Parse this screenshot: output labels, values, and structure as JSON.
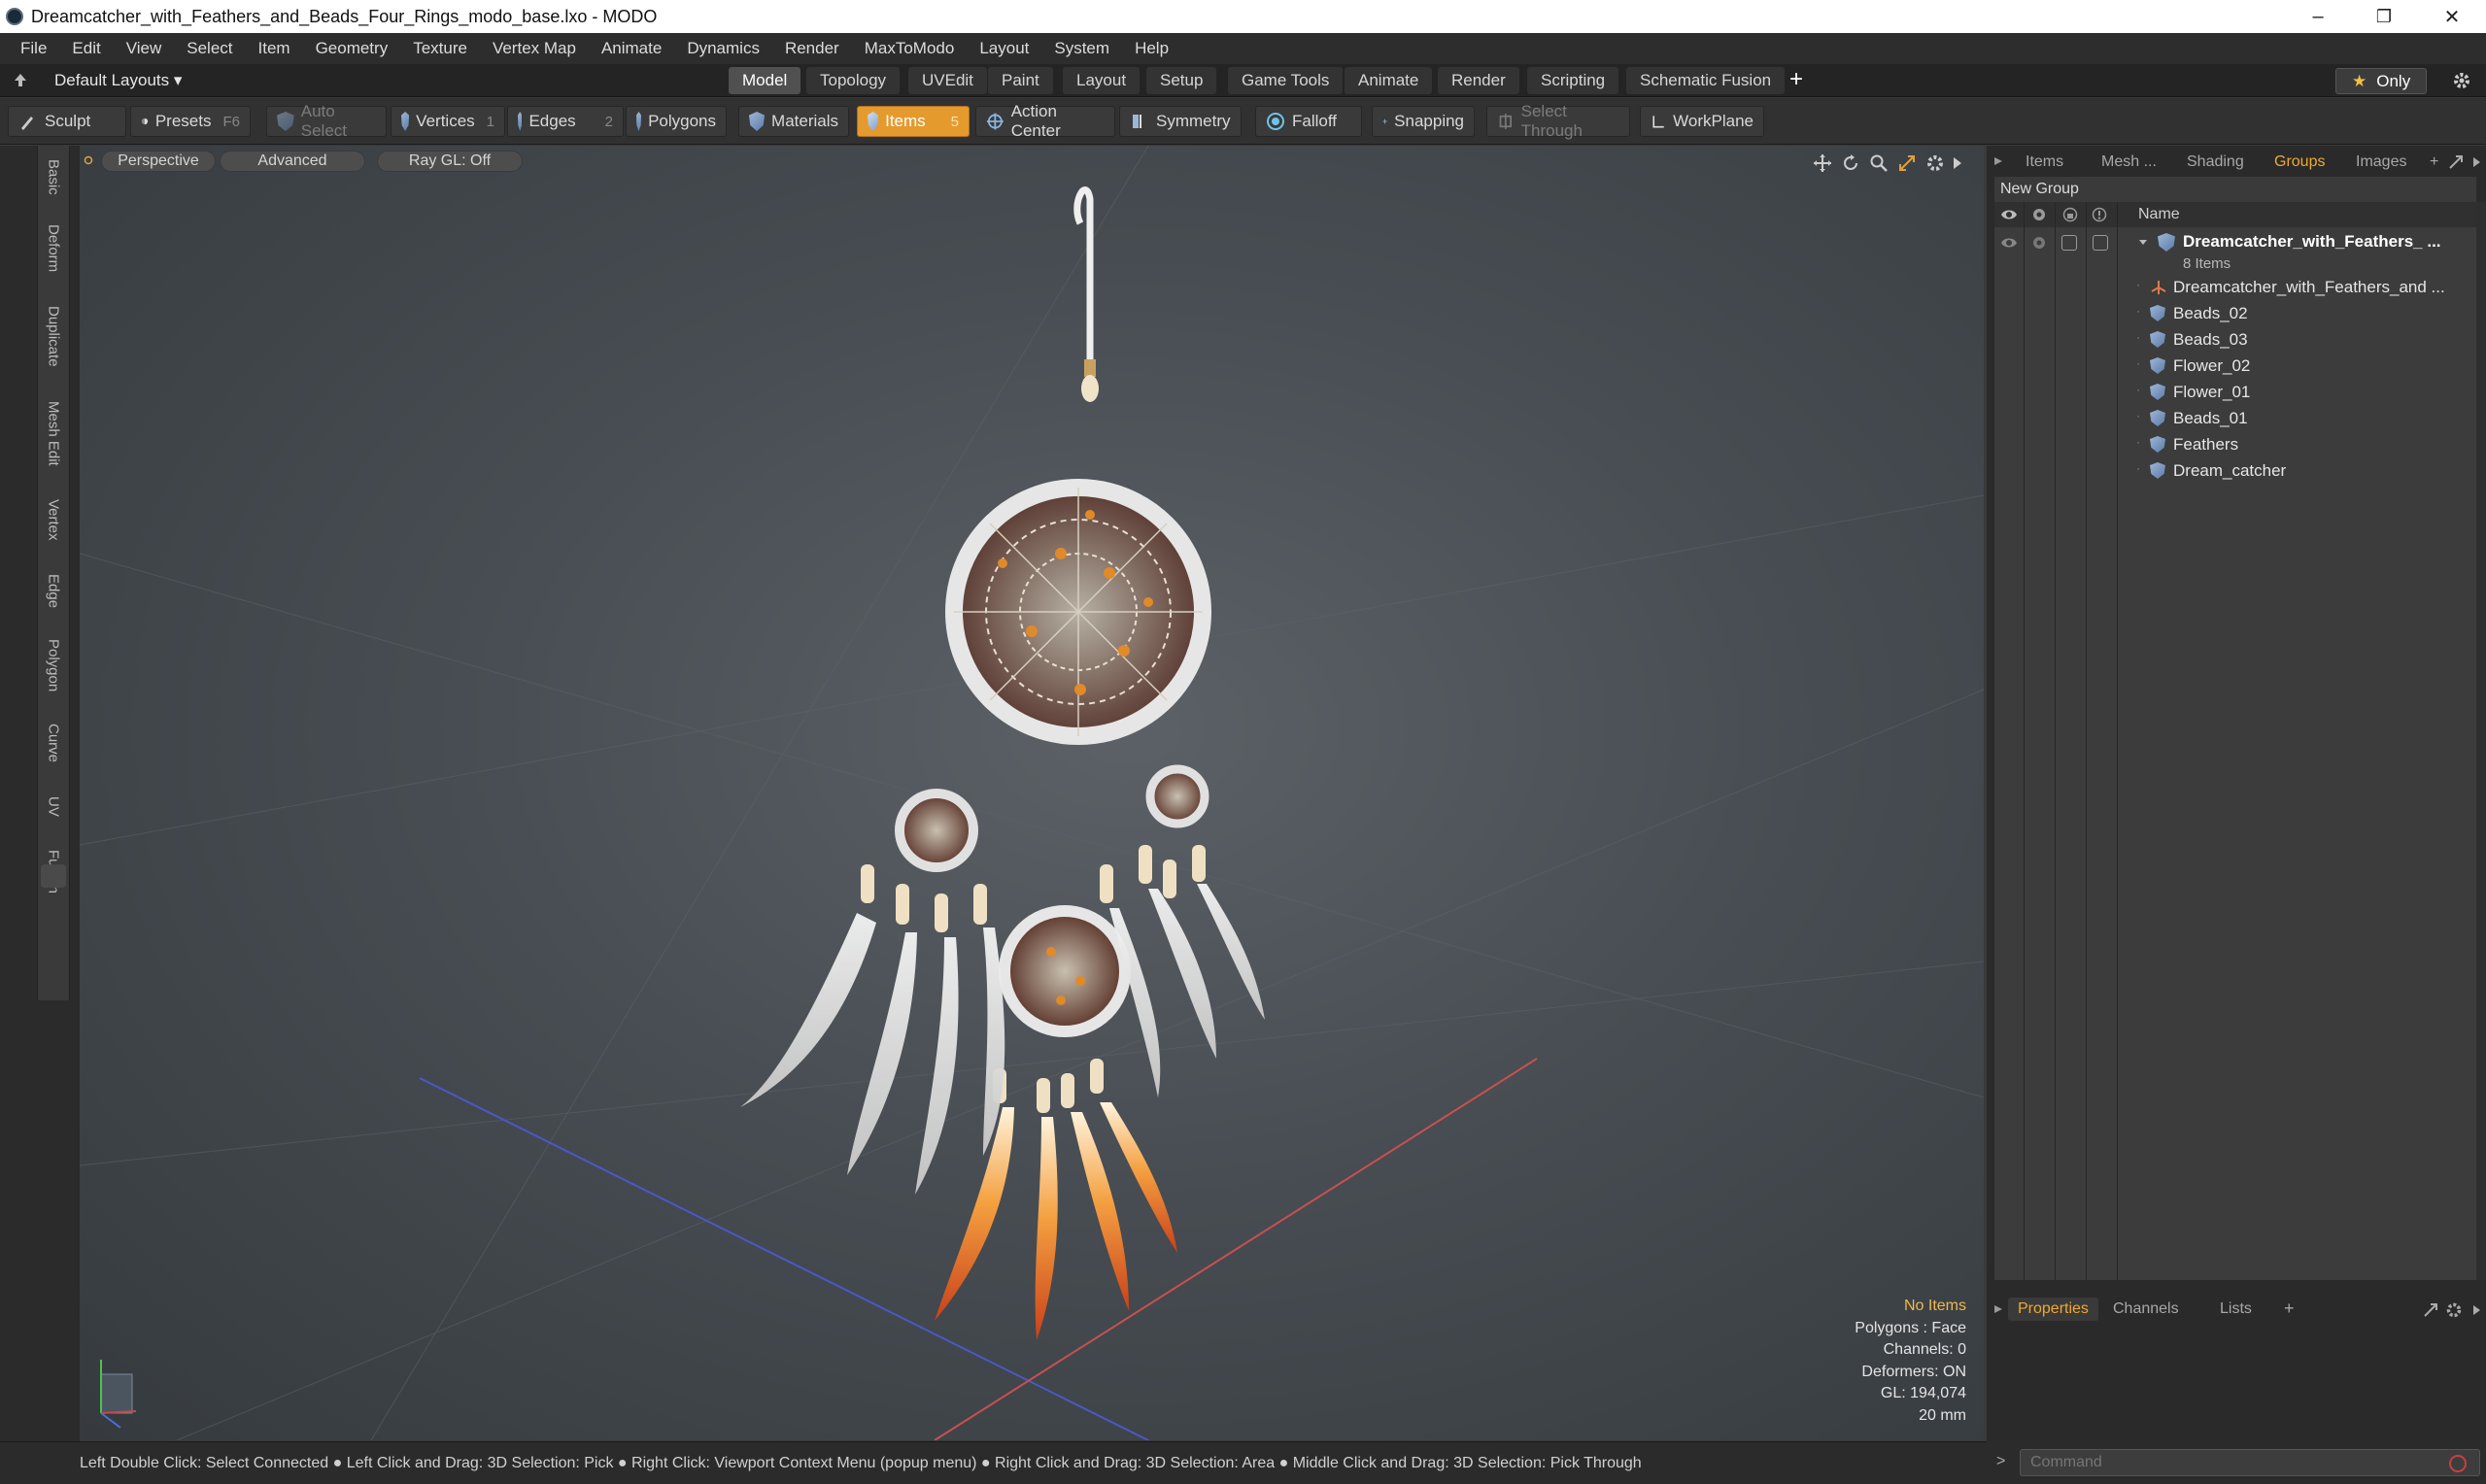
{
  "window": {
    "title": "Dreamcatcher_with_Feathers_and_Beads_Four_Rings_modo_base.lxo - MODO",
    "controls": {
      "minimize": "–",
      "restore": "❐",
      "close": "✕"
    }
  },
  "menu": [
    "File",
    "Edit",
    "View",
    "Select",
    "Item",
    "Geometry",
    "Texture",
    "Vertex Map",
    "Animate",
    "Dynamics",
    "Render",
    "MaxToModo",
    "Layout",
    "System",
    "Help"
  ],
  "layout_selector": "Default Layouts ▾",
  "tabs": [
    "Model",
    "Topology",
    "UVEdit",
    "Paint",
    "Layout",
    "Setup",
    "Game Tools",
    "Animate",
    "Render",
    "Scripting",
    "Schematic Fusion"
  ],
  "active_tab": "Model",
  "tab_add": "+",
  "only_button": {
    "icon": "★",
    "label": "Only"
  },
  "toolbar": {
    "sculpt": "Sculpt",
    "presets": "Presets",
    "presets_key": "F6",
    "auto_select": "Auto Select",
    "vertices": "Vertices",
    "vertices_count": "1",
    "edges": "Edges",
    "edges_count": "2",
    "polygons": "Polygons",
    "materials": "Materials",
    "items": "Items",
    "items_count": "5",
    "action_center": "Action Center",
    "symmetry": "Symmetry",
    "falloff": "Falloff",
    "snapping": "Snapping",
    "select_through": "Select Through",
    "workplane": "WorkPlane"
  },
  "left_tabs": [
    "Basic",
    "Deform",
    "Duplicate",
    "Mesh Edit",
    "Vertex",
    "Edge",
    "Polygon",
    "Curve",
    "UV",
    "Fusion"
  ],
  "viewport": {
    "view_mode": "Perspective",
    "shading": "Advanced",
    "raygl": "Ray GL: Off",
    "info": {
      "selection": "No Items",
      "polygons": "Polygons : Face",
      "channels": "Channels: 0",
      "deformers": "Deformers: ON",
      "gl": "GL: 194,074",
      "scale": "20 mm"
    }
  },
  "status_bar": "Left Double Click: Select Connected ● Left Click and Drag: 3D Selection: Pick ● Right Click: Viewport Context Menu (popup menu) ● Right Click and Drag: 3D Selection: Area ● Middle Click and Drag: 3D Selection: Pick Through",
  "right_panel": {
    "tabs": [
      "Items",
      "Mesh ...",
      "Shading",
      "Groups",
      "Images"
    ],
    "active_tab": "Groups",
    "tab_add": "+",
    "new_group": "New Group",
    "column_name": "Name",
    "group": {
      "name": "Dreamcatcher_with_Feathers_ ...",
      "count": "8 Items",
      "children": [
        "Dreamcatcher_with_Feathers_and ...",
        "Beads_02",
        "Beads_03",
        "Flower_02",
        "Flower_01",
        "Beads_01",
        "Feathers",
        "Dream_catcher"
      ]
    },
    "bottom_tabs": [
      "Properties",
      "Channels",
      "Lists"
    ],
    "bottom_active": "Properties",
    "bottom_add": "+",
    "command_placeholder": "Command",
    "command_prompt": ">"
  },
  "colors": {
    "accent": "#e59a2e",
    "active_tab_text": "#f0a830",
    "info_highlight": "#f0b84a"
  }
}
